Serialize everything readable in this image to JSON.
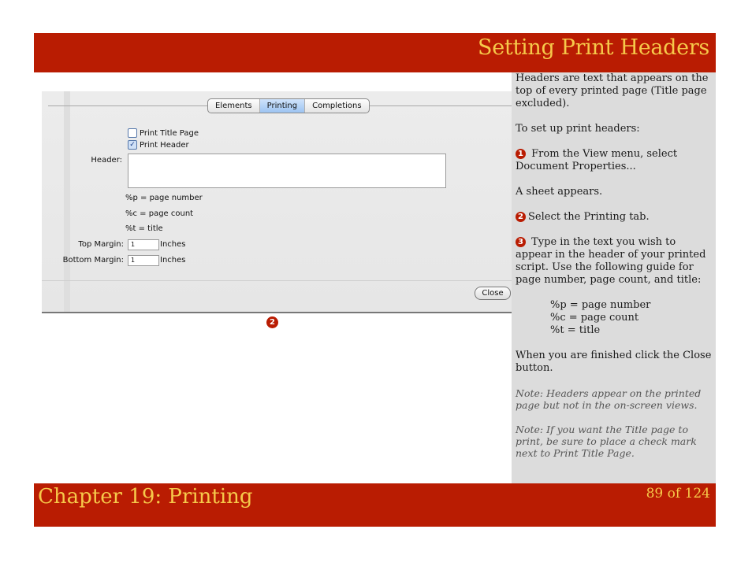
{
  "header": {
    "title": "Setting Print Headers"
  },
  "dialog": {
    "tabs": [
      "Elements",
      "Printing",
      "Completions"
    ],
    "active_tab": "Printing",
    "print_title_page": {
      "label": "Print Title Page",
      "checked": false
    },
    "print_header": {
      "label": "Print Header",
      "checked": true
    },
    "header_label": "Header:",
    "header_value": "",
    "hints": [
      "%p = page number",
      "%c = page count",
      "%t = title"
    ],
    "top_margin": {
      "label": "Top Margin:",
      "value": "1",
      "unit": "Inches"
    },
    "bottom_margin": {
      "label": "Bottom Margin:",
      "value": "1",
      "unit": "Inches"
    },
    "close_label": "Close"
  },
  "marker": "2",
  "sidebar": {
    "intro": "Headers are text that appears on the top of every printed page (Title page excluded).",
    "setup": "To set up print headers:",
    "step1_num": "1",
    "step1": "From the View menu, select Document Properties...",
    "sheet": "A sheet appears.",
    "step2_num": "2",
    "step2": "Select the Printing tab.",
    "step3_num": "3",
    "step3": "Type in the text you wish to appear in the header of your printed script. Use the following guide for page number, page count, and title:",
    "codes": [
      "%p = page number",
      "%c = page count",
      "%t = title"
    ],
    "finish": "When you are finished click the Close button.",
    "note1": "Note: Headers appear on the printed page but not in the on-screen views.",
    "note2": "Note: If you want the Title page to print, be sure to place a check mark next to Print Title Page."
  },
  "footer": {
    "chapter": "Chapter 19: Printing",
    "page": "89 of 124"
  },
  "colors": {
    "brand_red": "#b91c02",
    "title_gold": "#f6c94a",
    "sidebar_gray": "#dcdcdc"
  }
}
